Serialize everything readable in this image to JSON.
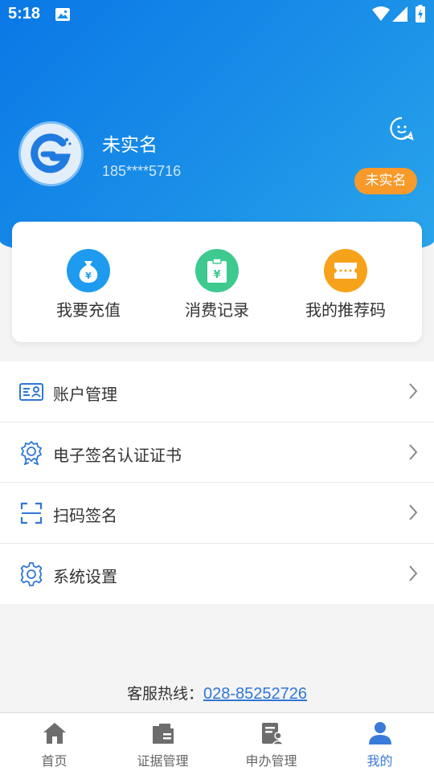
{
  "status_bar": {
    "time": "5:18"
  },
  "profile": {
    "name": "未实名",
    "phone": "185****5716",
    "badge": "未实名"
  },
  "quick_actions": [
    {
      "label": "我要充值",
      "icon": "money-bag-icon",
      "color": "#1e9bef"
    },
    {
      "label": "消费记录",
      "icon": "receipt-clipboard-icon",
      "color": "#3ec98f"
    },
    {
      "label": "我的推荐码",
      "icon": "ticket-icon",
      "color": "#f7a21b"
    }
  ],
  "menu": [
    {
      "label": "账户管理",
      "icon": "account-card-icon"
    },
    {
      "label": "电子签名认证证书",
      "icon": "certificate-badge-icon"
    },
    {
      "label": "扫码签名",
      "icon": "scan-icon"
    },
    {
      "label": "系统设置",
      "icon": "gear-icon"
    }
  ],
  "hotline": {
    "label": "客服热线：",
    "number": "028-85252726"
  },
  "tabbar": [
    {
      "label": "首页",
      "icon": "home-icon"
    },
    {
      "label": "证据管理",
      "icon": "evidence-folder-icon"
    },
    {
      "label": "申办管理",
      "icon": "application-doc-icon"
    },
    {
      "label": "我的",
      "icon": "user-icon",
      "active": true
    }
  ],
  "colors": {
    "primary": "#1a8fe8",
    "accent": "#3a7ad9",
    "badge": "#f79a2a"
  }
}
